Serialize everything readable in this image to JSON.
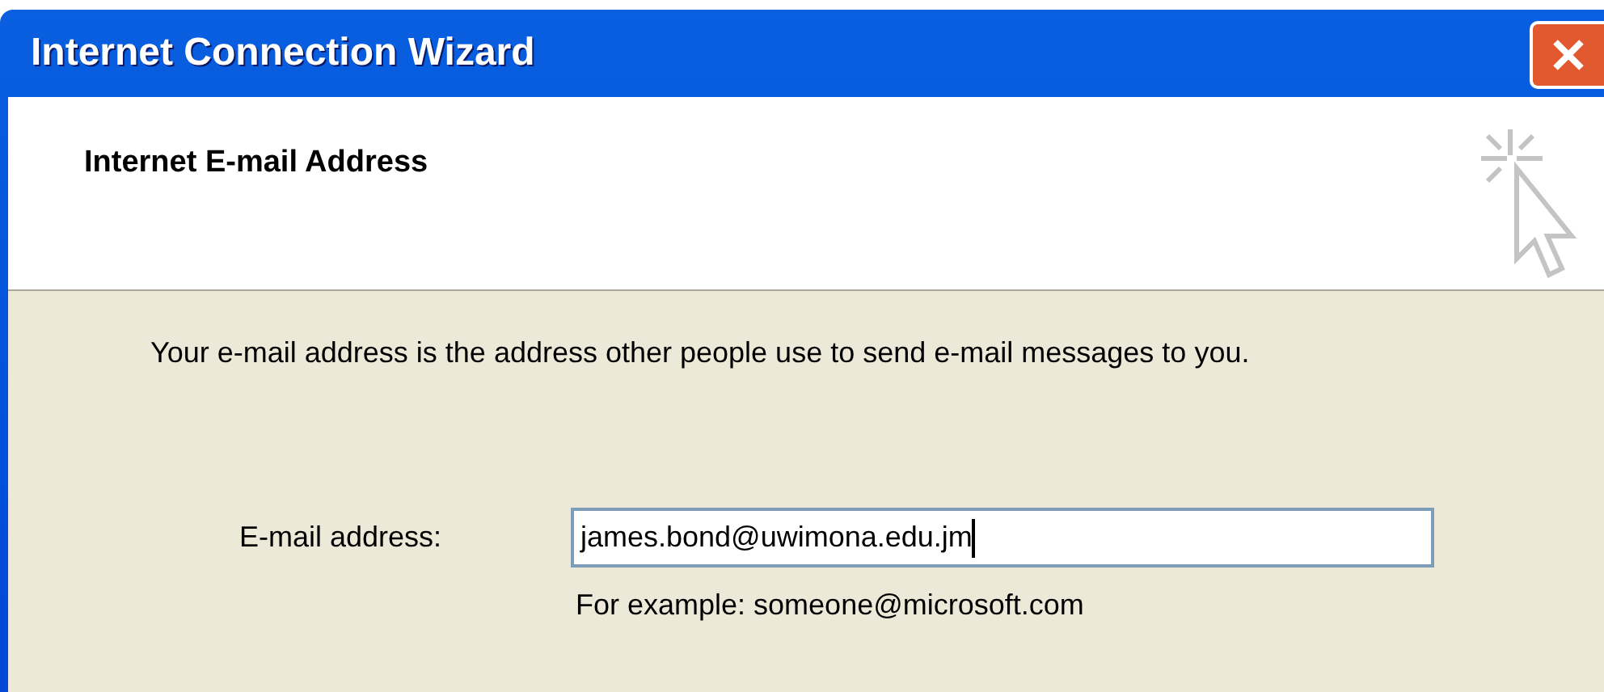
{
  "window": {
    "title": "Internet Connection Wizard"
  },
  "header": {
    "title": "Internet E-mail Address"
  },
  "description": "Your e-mail address is the address other people use to send e-mail messages to you.",
  "email_field": {
    "label": "E-mail address:",
    "value": "james.bond@uwimona.edu.jm",
    "focused": true
  },
  "example": "For example: someone@microsoft.com"
}
